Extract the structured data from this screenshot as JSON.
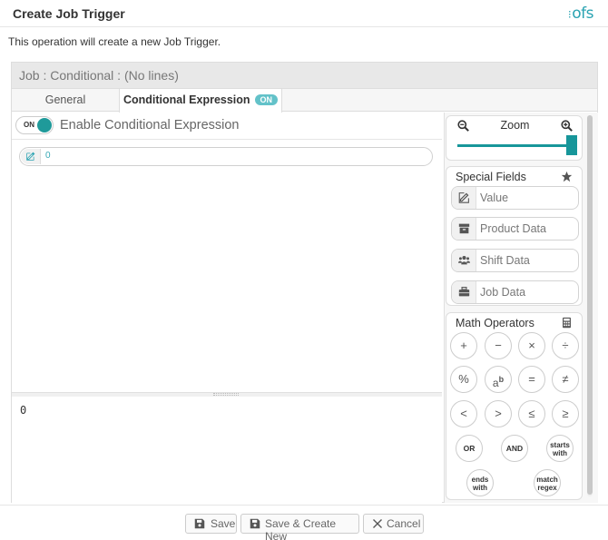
{
  "dialog": {
    "title": "Create Job Trigger",
    "logo": "ofs",
    "description": "This operation will create a new Job Trigger."
  },
  "panel": {
    "header": "Job : Conditional : (No lines)",
    "tabs": [
      {
        "label": "General"
      },
      {
        "label": "Conditional Expression",
        "badge": "ON"
      }
    ]
  },
  "conditional": {
    "toggle_state": "ON",
    "toggle_label": "Enable Conditional Expression",
    "expression_value": "0",
    "output_value": "0"
  },
  "zoom": {
    "label": "Zoom",
    "level": 1.0
  },
  "special_fields": {
    "title": "Special Fields",
    "items": [
      {
        "label": "Value",
        "icon": "edit-icon"
      },
      {
        "label": "Product Data",
        "icon": "archive-icon"
      },
      {
        "label": "Shift Data",
        "icon": "users-icon"
      },
      {
        "label": "Job Data",
        "icon": "briefcase-icon"
      }
    ]
  },
  "math_operators": {
    "title": "Math Operators",
    "ops": [
      "+",
      "−",
      "×",
      "÷",
      "%",
      "ab",
      "=",
      "≠",
      "<",
      ">",
      "≤",
      "≥",
      "OR",
      "AND",
      "starts with",
      "ends with",
      "match regex"
    ]
  },
  "footer": {
    "save": "Save",
    "save_create_new": "Save & Create New",
    "cancel": "Cancel"
  }
}
